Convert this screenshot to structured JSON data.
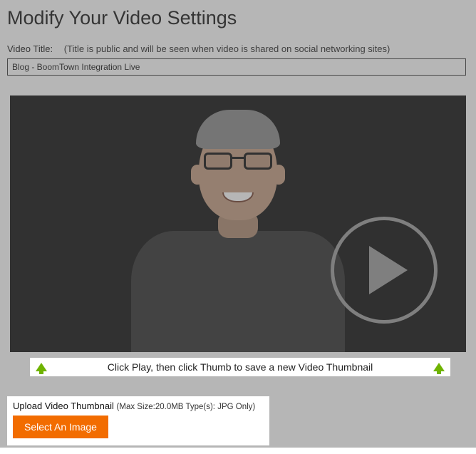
{
  "page": {
    "title": "Modify Your Video Settings"
  },
  "titleField": {
    "label": "Video Title:",
    "hint": "(Title is public and will be seen when video is shared on social networking sites)",
    "value": "Blog - BoomTown Integration Live"
  },
  "thumbBar": {
    "instruction": "Click Play, then click Thumb to save a new Video Thumbnail"
  },
  "upload": {
    "label": "Upload Video Thumbnail",
    "meta": "(Max Size:20.0MB  Type(s): JPG Only)",
    "button": "Select An Image"
  },
  "colors": {
    "accent": "#f26c00",
    "arrow": "#6fb300"
  }
}
